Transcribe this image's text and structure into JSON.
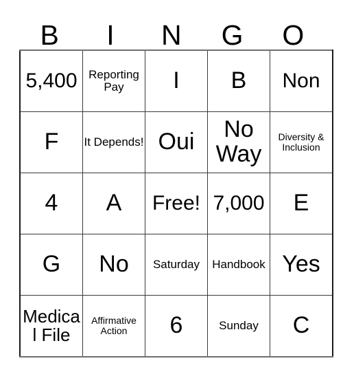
{
  "card": {
    "header": {
      "letters": [
        "B",
        "I",
        "N",
        "G",
        "O"
      ]
    },
    "rows": [
      [
        {
          "text": "5,400",
          "size": "lg"
        },
        {
          "text": "Reporting Pay",
          "size": "sm"
        },
        {
          "text": "I",
          "size": "xl"
        },
        {
          "text": "B",
          "size": "xl"
        },
        {
          "text": "Non",
          "size": "lg"
        }
      ],
      [
        {
          "text": "F",
          "size": "xl"
        },
        {
          "text": "It Depends!",
          "size": "sm"
        },
        {
          "text": "Oui",
          "size": "xl"
        },
        {
          "text": "No Way",
          "size": "xl"
        },
        {
          "text": "Diversity & Inclusion",
          "size": "xs"
        }
      ],
      [
        {
          "text": "4",
          "size": "xl"
        },
        {
          "text": "A",
          "size": "xl"
        },
        {
          "text": "Free!",
          "size": "lg"
        },
        {
          "text": "7,000",
          "size": "lg"
        },
        {
          "text": "E",
          "size": "xl"
        }
      ],
      [
        {
          "text": "G",
          "size": "xl"
        },
        {
          "text": "No",
          "size": "xl"
        },
        {
          "text": "Saturday",
          "size": "sm"
        },
        {
          "text": "Handbook",
          "size": "sm"
        },
        {
          "text": "Yes",
          "size": "xl"
        }
      ],
      [
        {
          "text": "Medical File",
          "size": "md"
        },
        {
          "text": "Affirmative Action",
          "size": "xs"
        },
        {
          "text": "6",
          "size": "xl"
        },
        {
          "text": "Sunday",
          "size": "sm"
        },
        {
          "text": "C",
          "size": "xl"
        }
      ]
    ],
    "free_space": {
      "row": 2,
      "column": 2,
      "label": "Free!"
    },
    "colors": {
      "text": "#000000",
      "background": "#ffffff",
      "grid_line": "#3a3a3a",
      "outer_border": "#6f6f6f"
    }
  }
}
